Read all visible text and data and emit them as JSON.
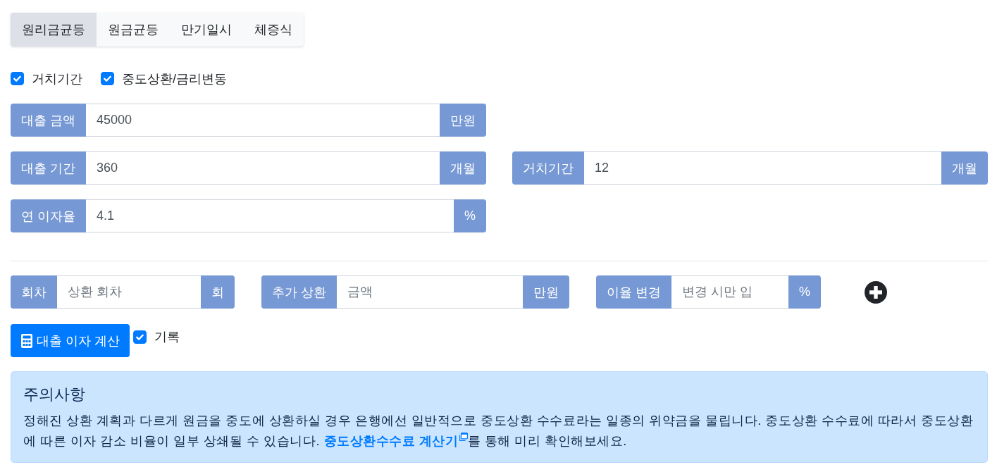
{
  "tabs": [
    {
      "label": "원리금균등",
      "selected": true
    },
    {
      "label": "원금균등",
      "selected": false
    },
    {
      "label": "만기일시",
      "selected": false
    },
    {
      "label": "체증식",
      "selected": false
    }
  ],
  "options": [
    {
      "label": "거치기간",
      "checked": true
    },
    {
      "label": "중도상환/금리변동",
      "checked": true
    }
  ],
  "loan_rows": [
    {
      "fields": [
        {
          "label": "대출 금액",
          "value": "45000",
          "unit": "만원"
        }
      ]
    },
    {
      "fields": [
        {
          "label": "대출 기간",
          "value": "360",
          "unit": "개월"
        },
        {
          "label": "거치기간",
          "value": "12",
          "unit": "개월"
        }
      ]
    },
    {
      "fields": [
        {
          "label": "연 이자율",
          "value": "4.1",
          "unit": "%"
        }
      ]
    }
  ],
  "prepayment_fields": [
    {
      "label": "회차",
      "placeholder": "상환 회차",
      "unit": "회"
    },
    {
      "label": "추가 상환",
      "placeholder": "금액",
      "unit": "만원"
    },
    {
      "label": "이율 변경",
      "placeholder": "변경 시만 입",
      "unit": "%"
    }
  ],
  "calculate_button": {
    "label": "대출 이자 계산"
  },
  "record_option": {
    "label": "기록",
    "checked": true
  },
  "notice": {
    "title": "주의사항",
    "text_before": "정해진 상환 계획과 다르게 원금을 중도에 상환하실 경우 은행에선 일반적으로 중도상환 수수료라는 일종의 위약금을 물립니다. 중도상환 수수료에 따라서 중도상환에 따른 이자 감소 비율이 일부 상쇄될 수 있습니다. ",
    "link": "중도상환수수료 계산기",
    "text_after": "를 통해 미리 확인해보세요."
  }
}
